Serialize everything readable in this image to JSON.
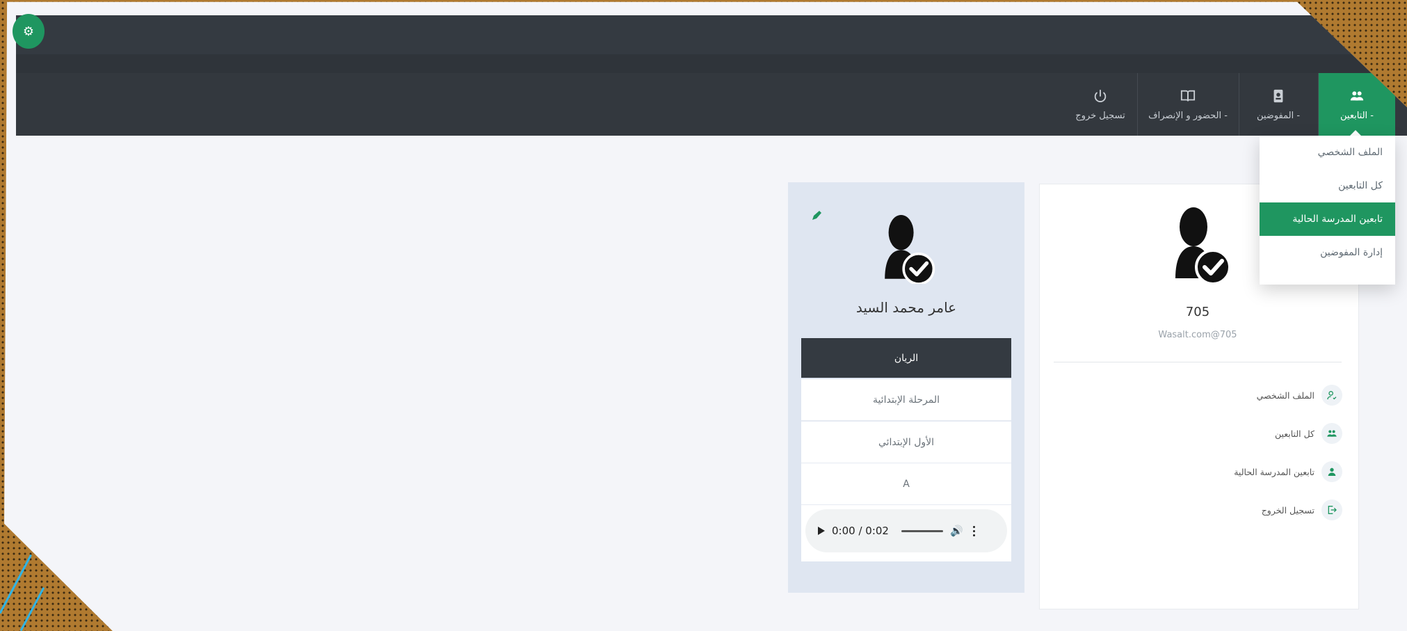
{
  "colors": {
    "accent": "#1f9660",
    "navbar": "#343a41",
    "background": "#f4f5f9",
    "frame": "#b07a30"
  },
  "gear_icon": "gear-icon",
  "nav": [
    {
      "label": "التابعين -",
      "icon": "users-icon",
      "active": true
    },
    {
      "label": "المفوضين -",
      "icon": "id-badge-icon",
      "active": false
    },
    {
      "label": "الحضور و الإنصراف -",
      "icon": "book-icon",
      "active": false
    },
    {
      "label": "تسجيل خروج",
      "icon": "power-icon",
      "active": false
    }
  ],
  "dropdown": [
    {
      "label": "الملف الشخصي",
      "active": false
    },
    {
      "label": "كل التابعين",
      "active": false
    },
    {
      "label": "تابعين المدرسة الحالية",
      "active": true
    },
    {
      "label": "إدارة المفوضين",
      "active": false
    }
  ],
  "profile": {
    "id": "705",
    "email": "Wasalt.com@705",
    "menu": [
      {
        "label": "الملف الشخصي",
        "icon": "user-check-icon"
      },
      {
        "label": "كل التابعين",
        "icon": "users-icon"
      },
      {
        "label": "تابعين المدرسة الحالية",
        "icon": "user-icon"
      },
      {
        "label": "تسجيل الخروج",
        "icon": "sign-out-icon"
      }
    ]
  },
  "student": {
    "name": "عامر محمد السيد",
    "school": "الريان",
    "stage": "المرحلة الإبتدائية",
    "grade": "الأول الإبتدائي",
    "section": "A",
    "audio_time": "0:00 / 0:02"
  }
}
